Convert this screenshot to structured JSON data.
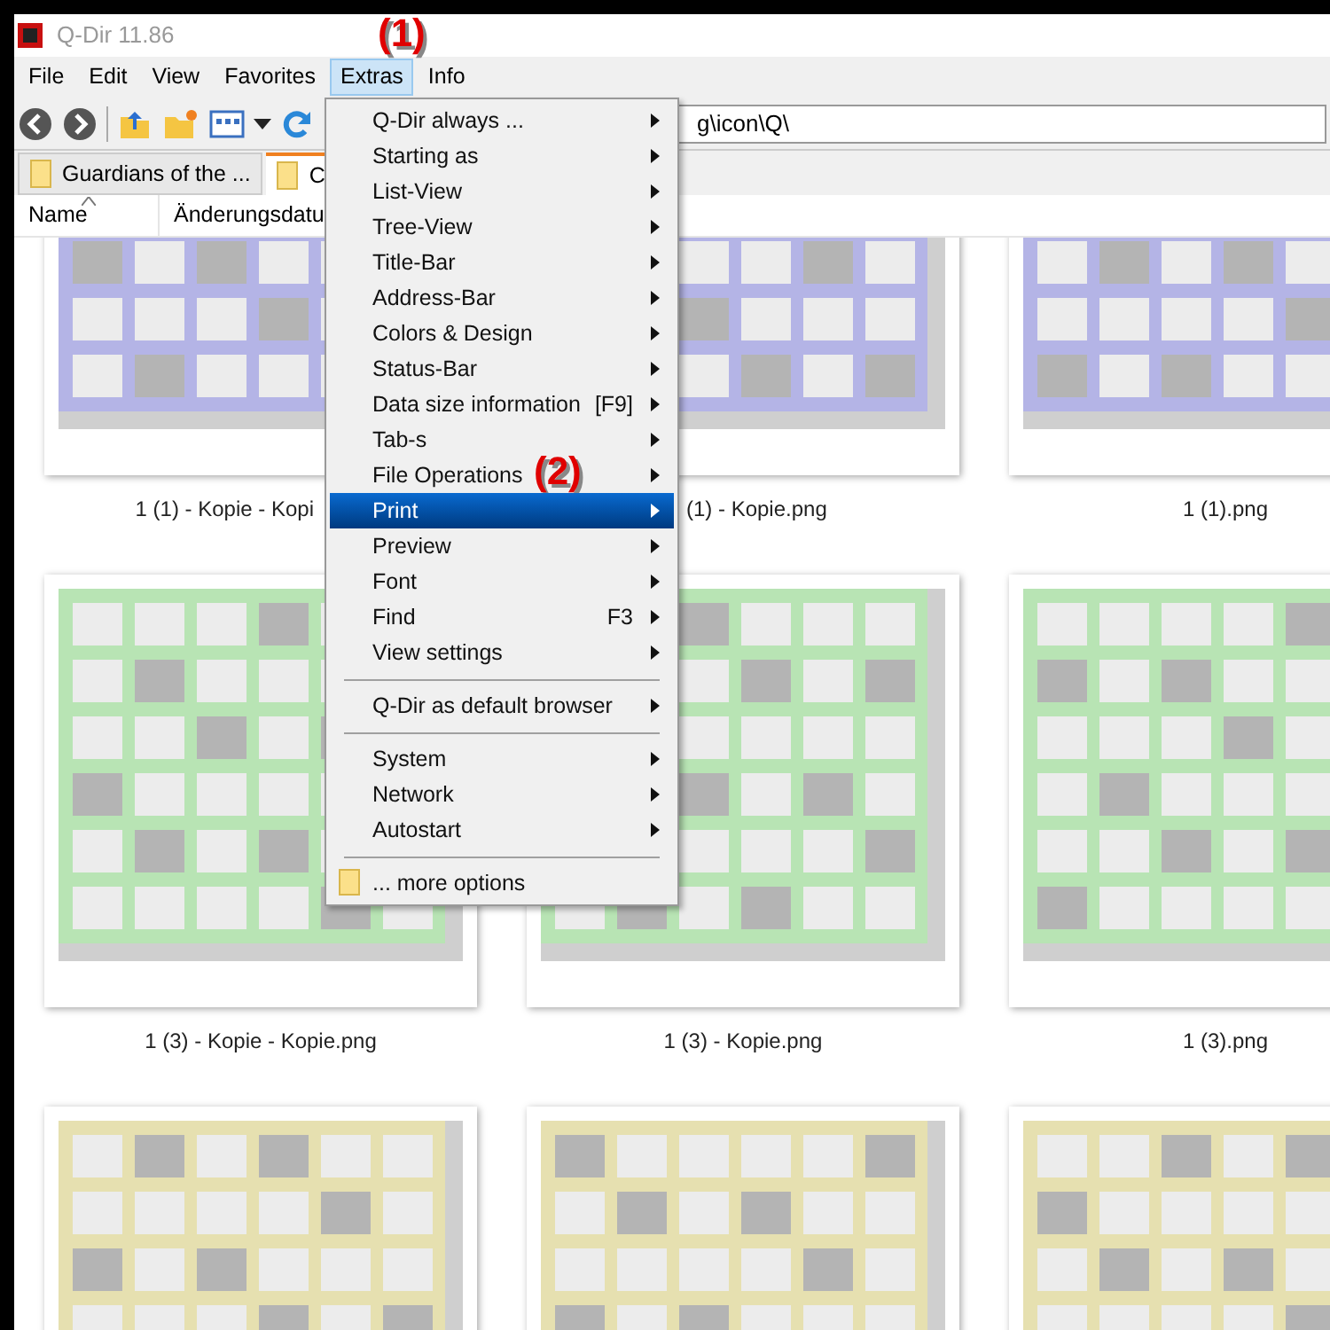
{
  "window": {
    "title": "Q-Dir 11.86"
  },
  "annotations": [
    {
      "text": "(1)"
    },
    {
      "text": "(2)"
    }
  ],
  "menubar": [
    {
      "label": "File",
      "selected": false
    },
    {
      "label": "Edit",
      "selected": false
    },
    {
      "label": "View",
      "selected": false
    },
    {
      "label": "Favorites",
      "selected": false
    },
    {
      "label": "Extras",
      "selected": true
    },
    {
      "label": "Info",
      "selected": false
    }
  ],
  "address": {
    "value": "g\\icon\\Q\\"
  },
  "tabs": [
    {
      "label": "Guardians of the ...",
      "selected": false
    },
    {
      "label": "C",
      "selected": true
    }
  ],
  "columns": [
    {
      "label": "Name",
      "sorted": true
    },
    {
      "label": "Änderungsdatu",
      "sorted": false
    }
  ],
  "menu": [
    {
      "kind": "item",
      "label": "Q-Dir always ...",
      "selected": false
    },
    {
      "kind": "item",
      "label": "Starting as",
      "selected": false
    },
    {
      "kind": "item",
      "label": "List-View",
      "selected": false
    },
    {
      "kind": "item",
      "label": "Tree-View",
      "selected": false
    },
    {
      "kind": "item",
      "label": "Title-Bar",
      "selected": false
    },
    {
      "kind": "item",
      "label": "Address-Bar",
      "selected": false
    },
    {
      "kind": "item",
      "label": "Colors & Design",
      "selected": false
    },
    {
      "kind": "item",
      "label": "Status-Bar",
      "selected": false
    },
    {
      "kind": "item",
      "label": "Data size information",
      "shortcut": "[F9]",
      "selected": false
    },
    {
      "kind": "item",
      "label": "Tab-s",
      "selected": false
    },
    {
      "kind": "item",
      "label": "File Operations",
      "selected": false
    },
    {
      "kind": "item",
      "label": "Print",
      "selected": true
    },
    {
      "kind": "item",
      "label": "Preview",
      "selected": false
    },
    {
      "kind": "item",
      "label": "Font",
      "selected": false
    },
    {
      "kind": "item",
      "label": "Find",
      "shortcut": "F3",
      "selected": false
    },
    {
      "kind": "item",
      "label": "View settings",
      "selected": false
    },
    {
      "kind": "separator"
    },
    {
      "kind": "item",
      "label": "Q-Dir as default browser",
      "selected": false
    },
    {
      "kind": "separator"
    },
    {
      "kind": "item",
      "label": "System",
      "selected": false
    },
    {
      "kind": "item",
      "label": "Network",
      "selected": false
    },
    {
      "kind": "item",
      "label": "Autostart",
      "selected": false
    },
    {
      "kind": "separator"
    },
    {
      "kind": "folder",
      "label": "... more options",
      "selected": false
    }
  ],
  "thumbnails": [
    {
      "label": "1 (1) - Kopie - Kopi",
      "color": "#b4b4e6"
    },
    {
      "label": "(1) - Kopie.png",
      "color": "#b4b4e6"
    },
    {
      "label": "1 (1).png",
      "color": "#b4b4e6"
    },
    {
      "label": "1 (3) - Kopie - Kopie.png",
      "color": "#b8e4b4"
    },
    {
      "label": "1 (3) - Kopie.png",
      "color": "#b8e4b4"
    },
    {
      "label": "1 (3).png",
      "color": "#b8e4b4"
    },
    {
      "color": "#e6e0b0"
    },
    {
      "color": "#e6e0b0"
    },
    {
      "color": "#e6e0b0"
    }
  ]
}
